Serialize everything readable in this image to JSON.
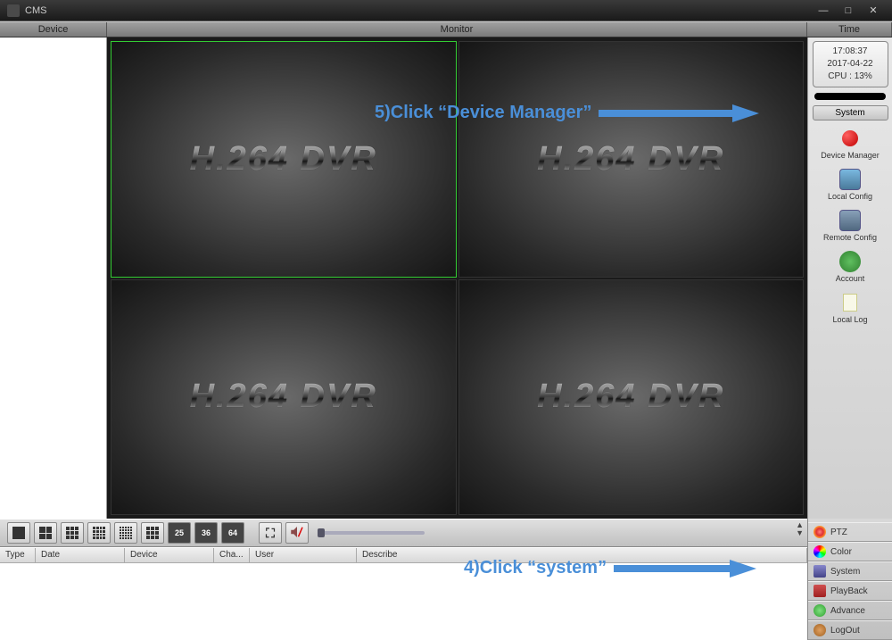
{
  "titlebar": {
    "title": "CMS"
  },
  "header": {
    "device": "Device",
    "monitor": "Monitor",
    "time": "Time"
  },
  "time_box": {
    "time": "17:08:37",
    "date": "2017-04-22",
    "cpu": "CPU : 13%"
  },
  "system_panel": {
    "header": "System",
    "items": [
      {
        "label": "Device Manager"
      },
      {
        "label": "Local Config"
      },
      {
        "label": "Remote Config"
      },
      {
        "label": "Account"
      },
      {
        "label": "Local Log"
      }
    ]
  },
  "video_text": "H.264 DVR",
  "layout_buttons": {
    "n25": "25",
    "n36": "36",
    "n64": "64"
  },
  "log_cols": {
    "type": "Type",
    "date": "Date",
    "device": "Device",
    "cha": "Cha...",
    "user": "User",
    "describe": "Describe"
  },
  "tabs": {
    "ptz": "PTZ",
    "color": "Color",
    "system": "System",
    "playback": "PlayBack",
    "advance": "Advance",
    "logout": "LogOut"
  },
  "annotations": {
    "step5": "5)Click “Device Manager”",
    "step4": "4)Click “system”"
  }
}
